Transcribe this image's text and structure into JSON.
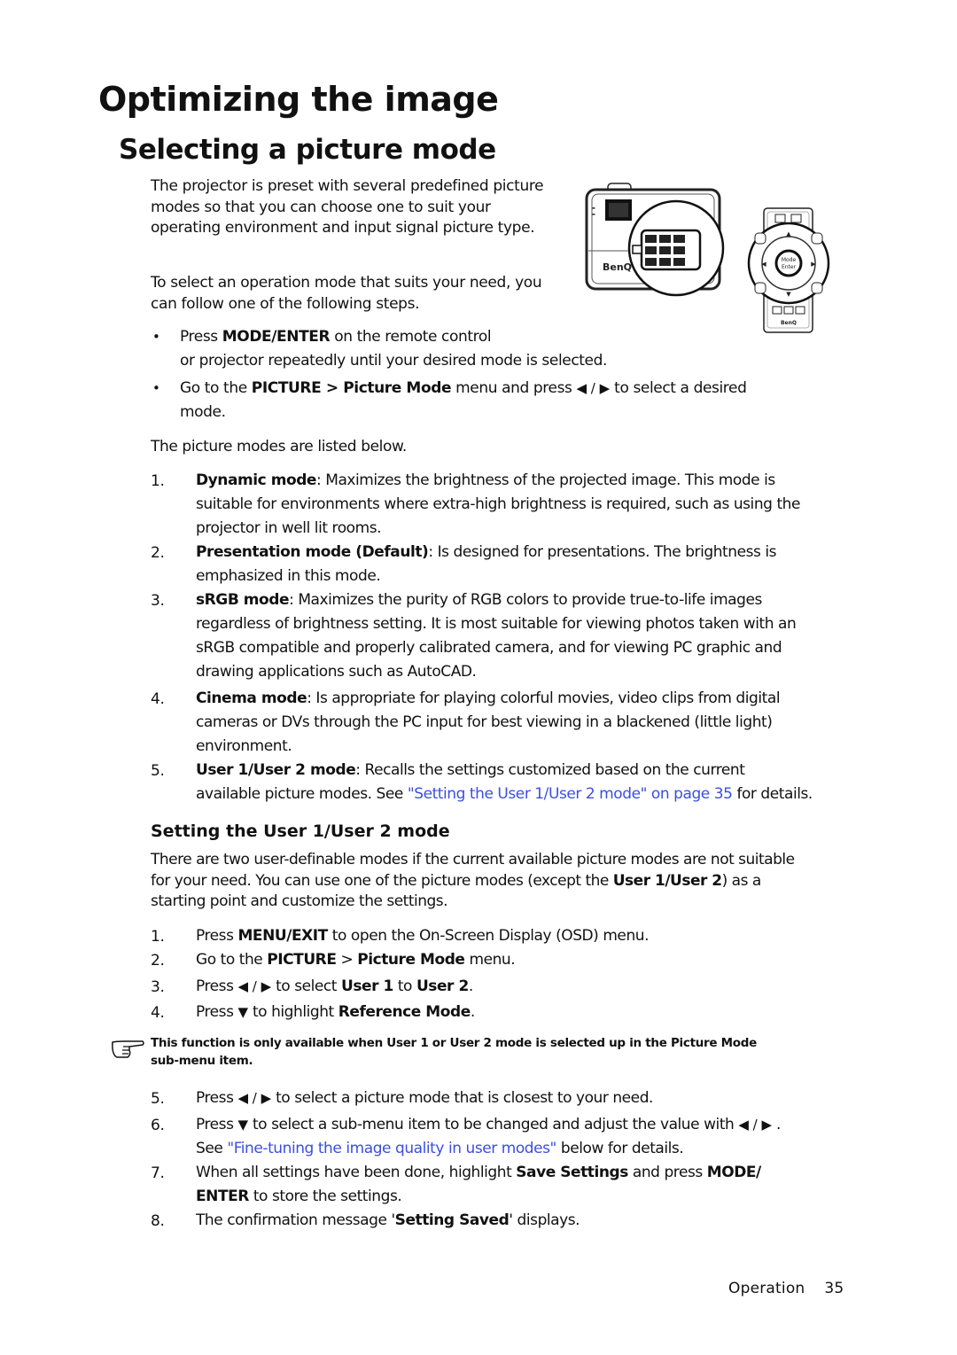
{
  "page": {
    "title": "Optimizing the image",
    "section_title": "Selecting a picture mode",
    "intro": {
      "p1": "The projector is preset with several predefined picture modes so that you can choose one to suit your operating environment and input signal picture type.",
      "p2": "To select an operation mode that suits your need, you can follow one of the following steps."
    },
    "illustration": {
      "projector_brand": "BenQ",
      "remote_brand": "BenQ",
      "remote_center_button": [
        "Mode",
        "Enter"
      ]
    },
    "bullets": [
      {
        "marker": "•",
        "pre": "Press ",
        "bold": "MODE/ENTER",
        "post": " on the remote control",
        "line2": "or projector repeatedly until your desired mode is selected."
      },
      {
        "marker": "•",
        "pre": "Go to the ",
        "bold1": "PICTURE > Picture Mode",
        "mid": " menu and press ",
        "arrows": "◀ / ▶",
        "post": " to select a desired",
        "line2": "mode."
      }
    ],
    "modes_intro": "The picture modes are listed below.",
    "modes": [
      {
        "num": "1.",
        "name": "Dynamic mode",
        "lines": [
          ": Maximizes the brightness of the projected image. This mode is",
          "suitable for environments where extra-high brightness is required, such as using the",
          "projector in well lit rooms."
        ]
      },
      {
        "num": "2.",
        "name": "Presentation mode (Default)",
        "lines": [
          ": Is designed for presentations. The brightness is",
          "emphasized in this mode."
        ]
      },
      {
        "num": "3.",
        "name": "sRGB mode",
        "lines": [
          ": Maximizes the purity of RGB colors to provide true-to-life images",
          "regardless of brightness setting. It is most suitable for viewing photos taken with an",
          "sRGB compatible and properly calibrated camera, and for viewing PC graphic and",
          "drawing applications such as AutoCAD."
        ]
      },
      {
        "num": "4.",
        "name": "Cinema mode",
        "lines": [
          ":  Is appropriate for playing colorful movies, video clips from digital",
          "cameras or DVs through the PC input for best viewing in a blackened (little light)",
          "environment."
        ]
      },
      {
        "num": "5.",
        "name": "User 1/User 2 mode",
        "lines": [
          ": Recalls the settings customized based on the current"
        ],
        "line2_pre": "available picture modes. See ",
        "line2_link": "\"Setting the User 1/User 2 mode\" on page 35",
        "line2_post": " for details."
      }
    ],
    "subsection": {
      "title": "Setting the User 1/User 2 mode",
      "para_lines": {
        "l1": "There are two user-definable modes if the current available picture modes are not suitable",
        "l2_pre": "for your need. You can use one of the picture modes (except the ",
        "l2_bold": "User 1/User 2",
        "l2_post": ") as a",
        "l3": "starting point and customize the settings."
      },
      "steps": [
        {
          "num": "1.",
          "pre": "Press ",
          "bold": "MENU/EXIT",
          "post": " to open the On-Screen Display (OSD) menu."
        },
        {
          "num": "2.",
          "pre": "Go to the ",
          "bold": "PICTURE",
          "mid": " > ",
          "bold2": "Picture Mode",
          "post": " menu."
        },
        {
          "num": "3.",
          "pre": "Press ",
          "arrows": "◀ / ▶",
          "mid": "  to select ",
          "bold": "User 1",
          "mid2": " to ",
          "bold2": "User 2",
          "post": "."
        },
        {
          "num": "4.",
          "pre": "Press ",
          "arrows": "▼",
          "mid": "  to highlight ",
          "bold": "Reference Mode",
          "post": "."
        }
      ],
      "note": {
        "icon": "pointing-hand-icon",
        "line1": "This function is only available when User 1 or User 2 mode is selected up in the Picture Mode",
        "line2": "sub-menu item."
      },
      "steps2": [
        {
          "num": "5.",
          "pre": "Press ",
          "arrows": "◀ / ▶",
          "post": "  to select a picture mode that is closest to your need."
        },
        {
          "num": "6.",
          "pre": "Press ",
          "arrows": "▼",
          "mid": "  to select a sub-menu item to be changed and adjust the value with ",
          "arrows2": "◀ / ▶",
          "post": " .",
          "line2_pre": "See ",
          "line2_link": "\"Fine-tuning the image quality in user modes\"",
          "line2_post": " below for details."
        },
        {
          "num": "7.",
          "pre": "When all settings have been done, highlight ",
          "bold": "Save Settings",
          "mid": " and press ",
          "bold2": "MODE/",
          "line2_bold": "ENTER",
          "line2_post": " to store the settings."
        },
        {
          "num": "8.",
          "pre": "The confirmation message '",
          "bold": "Setting Saved",
          "post": "' displays."
        }
      ]
    },
    "footer": {
      "section": "Operation",
      "page_number": "35"
    },
    "colors": {
      "link": "#3b4fe0",
      "text": "#111111"
    }
  }
}
